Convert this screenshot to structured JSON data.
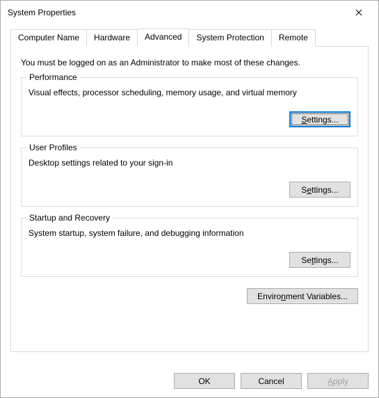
{
  "window": {
    "title": "System Properties"
  },
  "tabs": {
    "computer_name": "Computer Name",
    "hardware": "Hardware",
    "advanced": "Advanced",
    "system_protection": "System Protection",
    "remote": "Remote"
  },
  "content": {
    "admin_note": "You must be logged on as an Administrator to make most of these changes."
  },
  "groups": {
    "performance": {
      "title": "Performance",
      "desc": "Visual effects, processor scheduling, memory usage, and virtual memory",
      "button_prefix": "S",
      "button_rest": "ettings..."
    },
    "user_profiles": {
      "title": "User Profiles",
      "desc": "Desktop settings related to your sign-in",
      "button_prefix": "Settings...",
      "button_mn": "e"
    },
    "startup": {
      "title": "Startup and Recovery",
      "desc": "System startup, system failure, and debugging information",
      "button_prefix": "Settings...",
      "button_mn": "t"
    }
  },
  "env_button": {
    "label_prefix": "Enviro",
    "label_mn": "n",
    "label_rest": "ment Variables..."
  },
  "bottom": {
    "ok": "OK",
    "cancel": "Cancel",
    "apply_mn": "A",
    "apply_rest": "pply"
  }
}
